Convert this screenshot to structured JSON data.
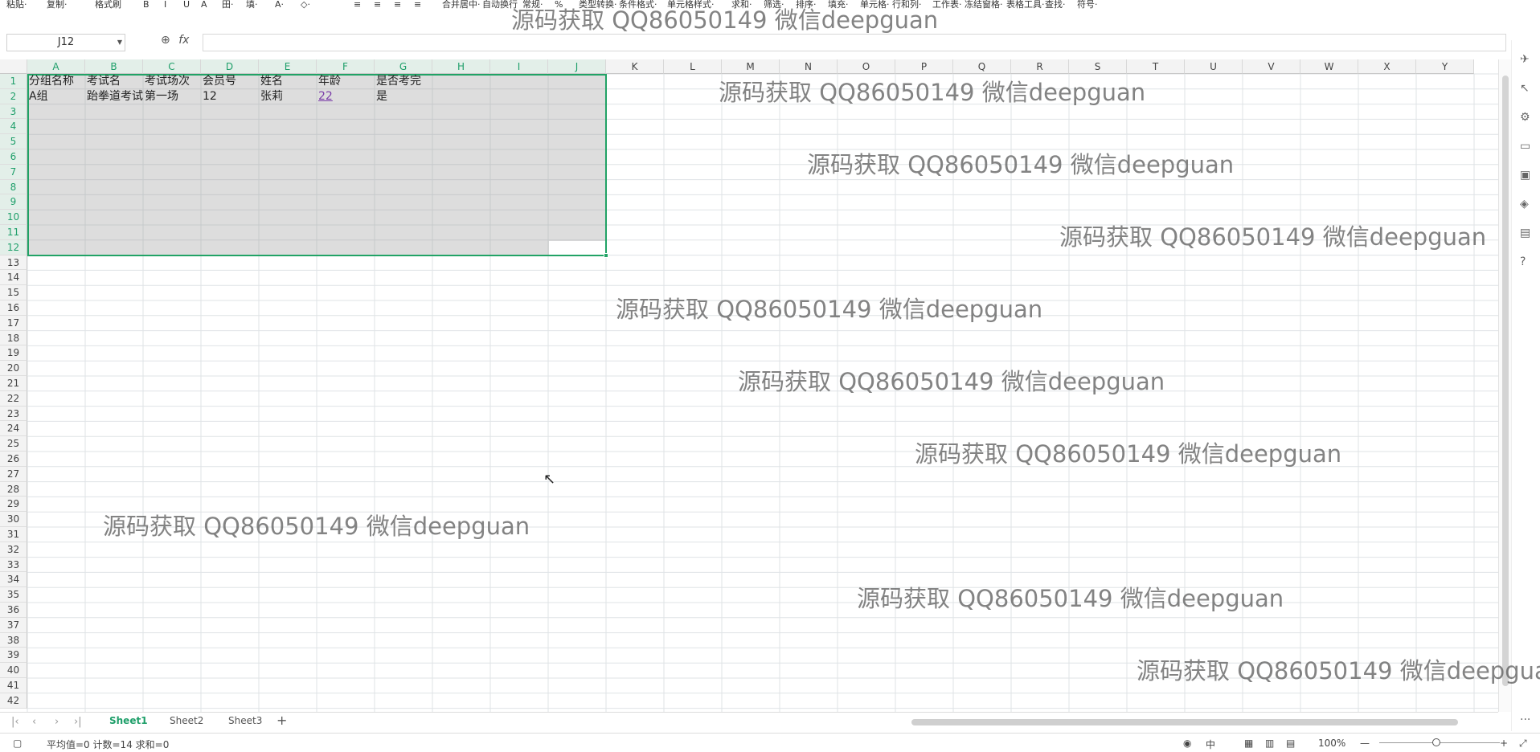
{
  "toolbar": {
    "items": [
      "粘贴·",
      "复制·",
      "格式刷",
      "B",
      "I",
      "U",
      "A",
      "田·",
      "填·",
      "A·",
      "◇·",
      "≡",
      "≡",
      "≡",
      "≡",
      "合并居中·",
      "自动换行",
      "常规·",
      "%",
      "类型转换·",
      "条件格式·",
      "单元格样式·",
      "求和·",
      "筛选·",
      "排序·",
      "填充·",
      "单元格·",
      "行和列·",
      "工作表·",
      "冻结窗格·",
      "表格工具·",
      "查找·",
      "符号·"
    ]
  },
  "formula_bar": {
    "name_box": "J12",
    "fx_label": "fx",
    "formula": ""
  },
  "columns": [
    "A",
    "B",
    "C",
    "D",
    "E",
    "F",
    "G",
    "H",
    "I",
    "J",
    "K",
    "L",
    "M",
    "N",
    "O",
    "P",
    "Q",
    "R",
    "S",
    "T",
    "U",
    "V",
    "W",
    "X",
    "Y"
  ],
  "rows": [
    "1",
    "2",
    "3",
    "4",
    "5",
    "6",
    "7",
    "8",
    "9",
    "10",
    "11",
    "12",
    "13",
    "14",
    "15",
    "16",
    "17",
    "18",
    "19",
    "20",
    "21",
    "22",
    "23",
    "24",
    "25",
    "26",
    "27",
    "28",
    "29",
    "30",
    "31",
    "32",
    "33",
    "34",
    "35",
    "36",
    "37",
    "38",
    "39",
    "40",
    "41",
    "42"
  ],
  "cells": {
    "row1": [
      "分组名称",
      "考试名",
      "考试场次",
      "会员号",
      "姓名",
      "年龄",
      "是否考完"
    ],
    "row2": [
      "A组",
      "跆拳道考试",
      "第一场",
      "12",
      "张莉",
      "22",
      "是"
    ]
  },
  "watermark": "源码获取 QQ86050149 微信deepguan",
  "sheets": [
    "Sheet1",
    "Sheet2",
    "Sheet3"
  ],
  "add_sheet": "+",
  "status": {
    "summary": "平均值=0  计数=14  求和=0",
    "zoom": "100%",
    "zoom_minus": "—",
    "zoom_plus": "+"
  }
}
